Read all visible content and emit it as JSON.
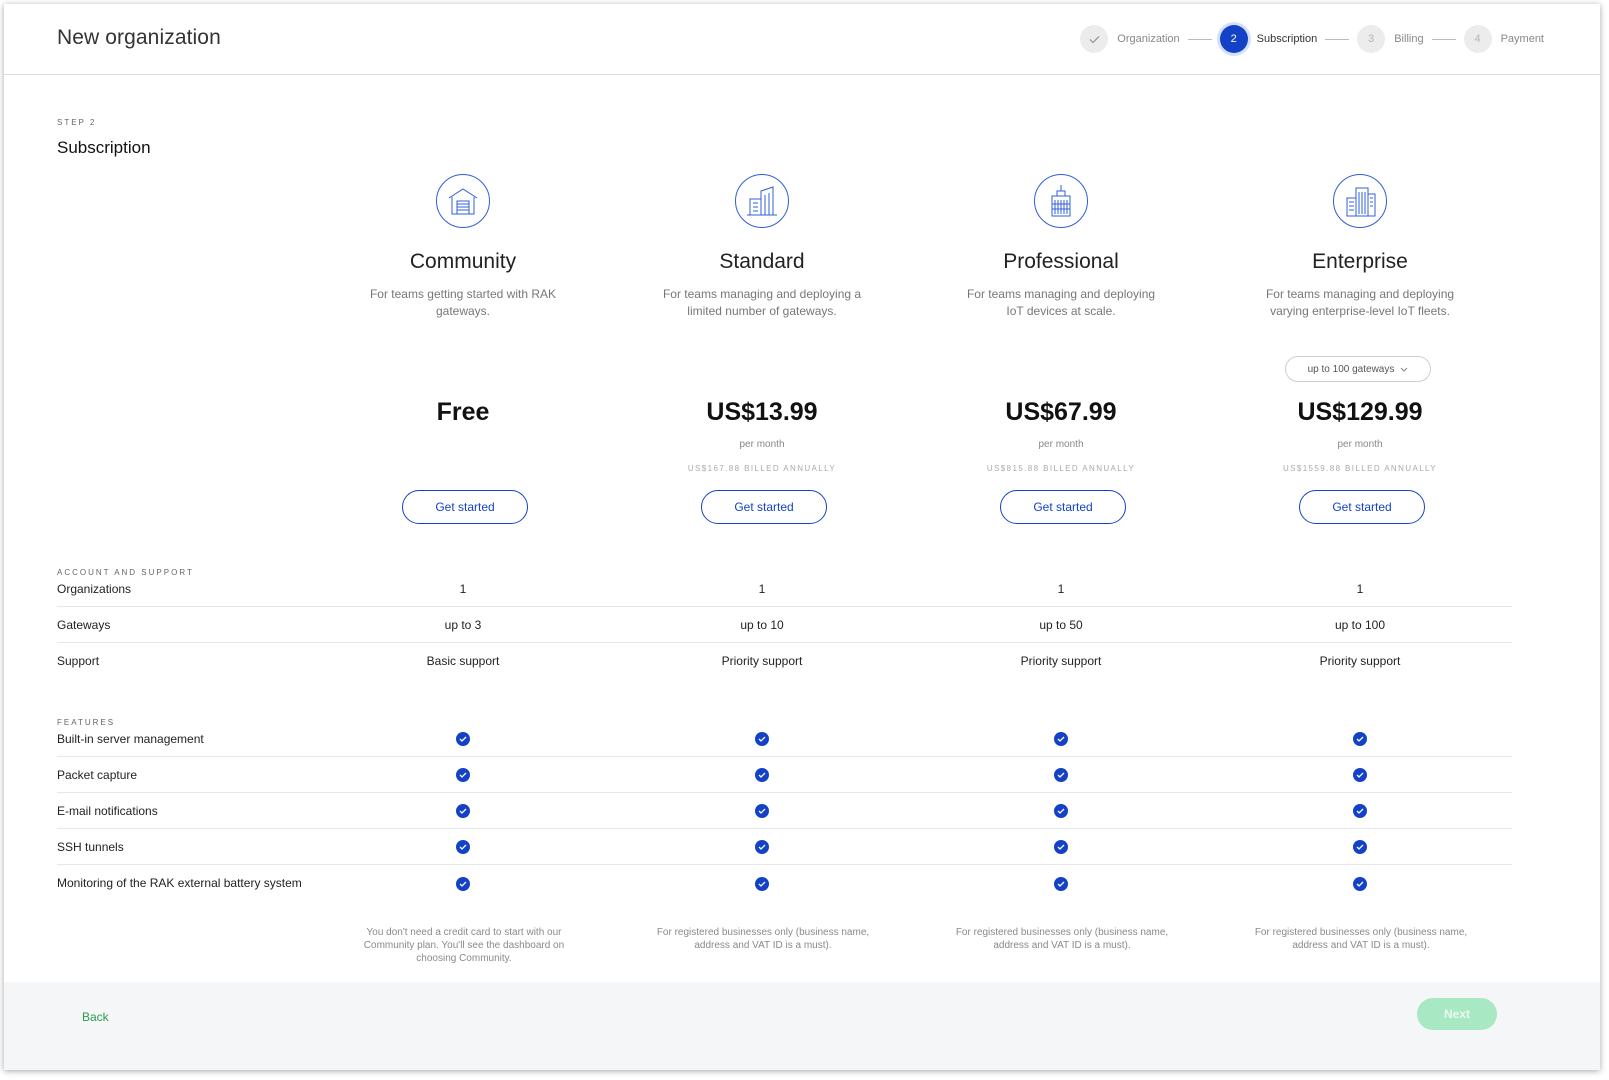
{
  "header": {
    "title": "New organization",
    "steps": [
      {
        "number": "✓",
        "label": "Organization",
        "state": "done"
      },
      {
        "number": "2",
        "label": "Subscription",
        "state": "active"
      },
      {
        "number": "3",
        "label": "Billing",
        "state": "pending"
      },
      {
        "number": "4",
        "label": "Payment",
        "state": "pending"
      }
    ]
  },
  "content": {
    "eyebrow": "STEP 2",
    "title": "Subscription"
  },
  "plans": [
    {
      "name": "Community",
      "description": "For teams getting started with RAK gateways.",
      "price": "Free",
      "period": "",
      "annual": "",
      "button": "Get started",
      "note": "You don't need a credit card to start with our Community plan. You'll see the dashboard on choosing Community.",
      "icon": "warehouse-icon"
    },
    {
      "name": "Standard",
      "description": "For teams managing and deploying a limited number of gateways.",
      "price": "US$13.99",
      "period": "per month",
      "annual": "US$167.88 BILLED ANNUALLY",
      "button": "Get started",
      "note": "For registered businesses only (business name, address and VAT ID is a must).",
      "icon": "office-building-icon"
    },
    {
      "name": "Professional",
      "description": "For teams managing and deploying IoT devices at scale.",
      "price": "US$67.99",
      "period": "per month",
      "annual": "US$815.88 BILLED ANNUALLY",
      "button": "Get started",
      "note": "For registered businesses only (business name, address and VAT ID is a must).",
      "icon": "skyscraper-icon"
    },
    {
      "name": "Enterprise",
      "description": "For teams managing and deploying varying enterprise-level IoT fleets.",
      "price": "US$129.99",
      "period": "per month",
      "annual": "US$1559.88 BILLED ANNUALLY",
      "button": "Get started",
      "note": "For registered businesses only (business name, address and VAT ID is a must).",
      "icon": "city-buildings-icon",
      "gateway_select": "up to 100 gateways"
    }
  ],
  "account_support": {
    "heading": "ACCOUNT AND SUPPORT",
    "rows": [
      {
        "label": "Organizations",
        "values": [
          "1",
          "1",
          "1",
          "1"
        ]
      },
      {
        "label": "Gateways",
        "values": [
          "up to 3",
          "up to 10",
          "up to 50",
          "up to 100"
        ]
      },
      {
        "label": "Support",
        "values": [
          "Basic support",
          "Priority support",
          "Priority support",
          "Priority support"
        ]
      }
    ]
  },
  "features": {
    "heading": "FEATURES",
    "rows": [
      {
        "label": "Built-in server management"
      },
      {
        "label": "Packet capture"
      },
      {
        "label": "E-mail notifications"
      },
      {
        "label": "SSH tunnels"
      },
      {
        "label": "Monitoring of the RAK external battery system"
      }
    ]
  },
  "footer": {
    "back": "Back",
    "next": "Next"
  },
  "colors": {
    "accent": "#1442c7",
    "success": "#2a9d4e",
    "next_disabled": "#a8e8c3"
  }
}
